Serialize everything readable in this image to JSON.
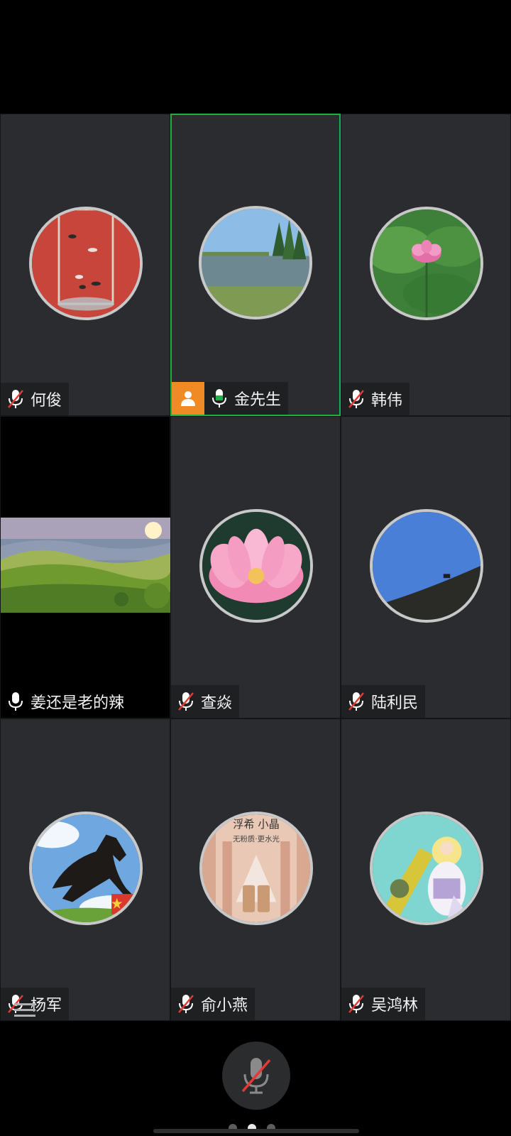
{
  "meeting": {
    "participants": [
      {
        "name": "何俊",
        "mic": "muted",
        "avatar": "goldfish-painting"
      },
      {
        "name": "金先生",
        "mic": "on",
        "host": true,
        "active_speaker": true,
        "avatar": "lake-landscape"
      },
      {
        "name": "韩伟",
        "mic": "muted",
        "avatar": "lotus-pond"
      },
      {
        "name": "姜还是老的辣",
        "mic": "on",
        "video": true,
        "avatar": "green-hills-sunrise"
      },
      {
        "name": "查焱",
        "mic": "muted",
        "avatar": "pink-lotus"
      },
      {
        "name": "陆利民",
        "mic": "muted",
        "avatar": "blue-sky-hill"
      },
      {
        "name": "杨军",
        "mic": "muted",
        "avatar": "black-horse"
      },
      {
        "name": "俞小燕",
        "mic": "muted",
        "avatar": "cosmetics-ad"
      },
      {
        "name": "吴鸿林",
        "mic": "muted",
        "avatar": "anime-robot"
      }
    ],
    "ad_text": [
      "浮希 小晶",
      "无粉质·更水光"
    ]
  },
  "controls": {
    "main_mic_state": "muted",
    "page_count": 3,
    "current_page": 2
  },
  "colors": {
    "tile_bg": "#2a2c2f",
    "active_border": "#18b248",
    "host_badge": "#f08a24",
    "muted_red": "#e53935"
  }
}
